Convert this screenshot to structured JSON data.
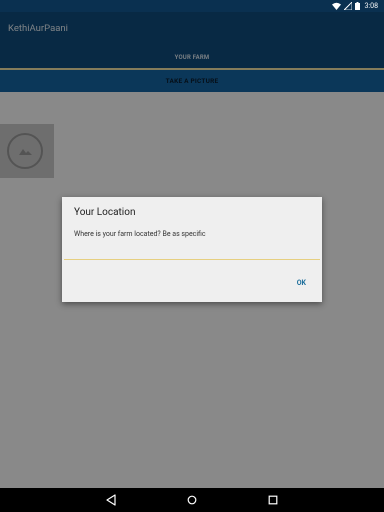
{
  "status_bar": {
    "time": "3:08",
    "icons": [
      "wifi-icon",
      "signal-icon",
      "battery-icon"
    ]
  },
  "app_bar": {
    "title": "KethiAurPaani"
  },
  "tabs": [
    {
      "label": "YOUR FARM",
      "selected": true
    },
    {
      "label": "TAKE A PICTURE",
      "selected": false
    }
  ],
  "content": {
    "image_placeholder_icon": "image-placeholder-icon"
  },
  "dialog": {
    "title": "Your Location",
    "message": "Where is your farm located? Be as specific",
    "input_value": "",
    "ok_label": "OK"
  },
  "nav_bar": {
    "icons": [
      "back-icon",
      "home-icon",
      "recents-icon"
    ]
  },
  "colors": {
    "status_bar": "#0a3050",
    "app_bar": "#0f4c7d",
    "tab_selected_bg": "#0f4c7d",
    "tab_unselected_bg": "#1565a3",
    "tab_indicator": "#f1e2a7",
    "dialog_bg": "#efefef",
    "ok_button": "#1e6f9c",
    "input_underline": "#e6cf80"
  }
}
